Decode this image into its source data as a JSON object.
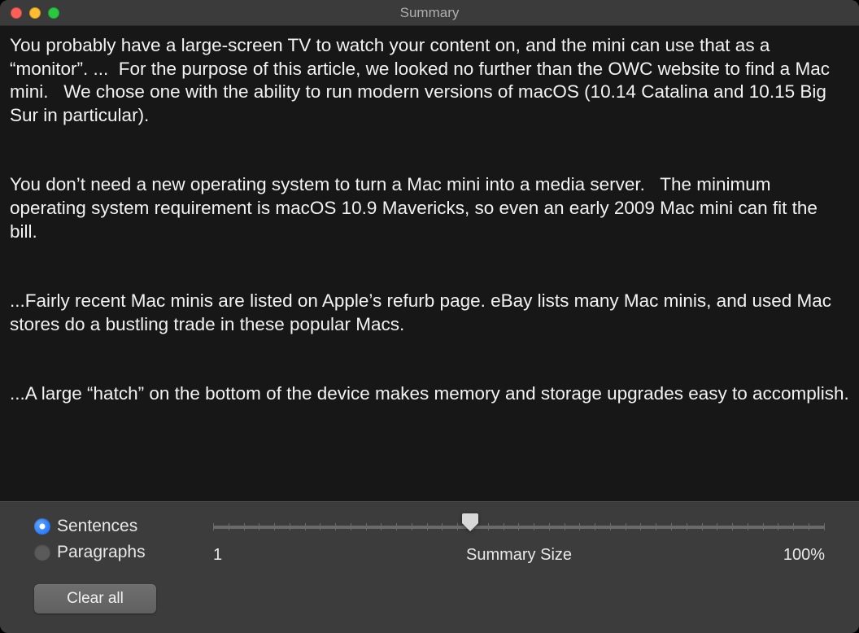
{
  "window": {
    "title": "Summary"
  },
  "summary": {
    "text": "You probably have a large-screen TV to watch your content on, and the mini can use that as a “monitor”. ...  For the purpose of this article, we looked no further than the OWC website to find a Mac mini.   We chose one with the ability to run modern versions of macOS (10.14 Catalina and 10.15 Big Sur in particular).\n\n\nYou don’t need a new operating system to turn a Mac mini into a media server.   The minimum operating system requirement is macOS 10.9 Mavericks, so even an early 2009 Mac mini can fit the bill.\n\n\n...Fairly recent Mac minis are listed on Apple’s refurb page. eBay lists many Mac minis, and used Mac stores do a bustling trade in these popular Macs.\n\n\n...A large “hatch” on the bottom of the device makes memory and storage upgrades easy to accomplish."
  },
  "controls": {
    "mode": {
      "sentences_label": "Sentences",
      "paragraphs_label": "Paragraphs",
      "selected": "sentences"
    },
    "slider": {
      "min_label": "1",
      "center_label": "Summary Size",
      "max_label": "100%"
    },
    "clear_label": "Clear all"
  }
}
